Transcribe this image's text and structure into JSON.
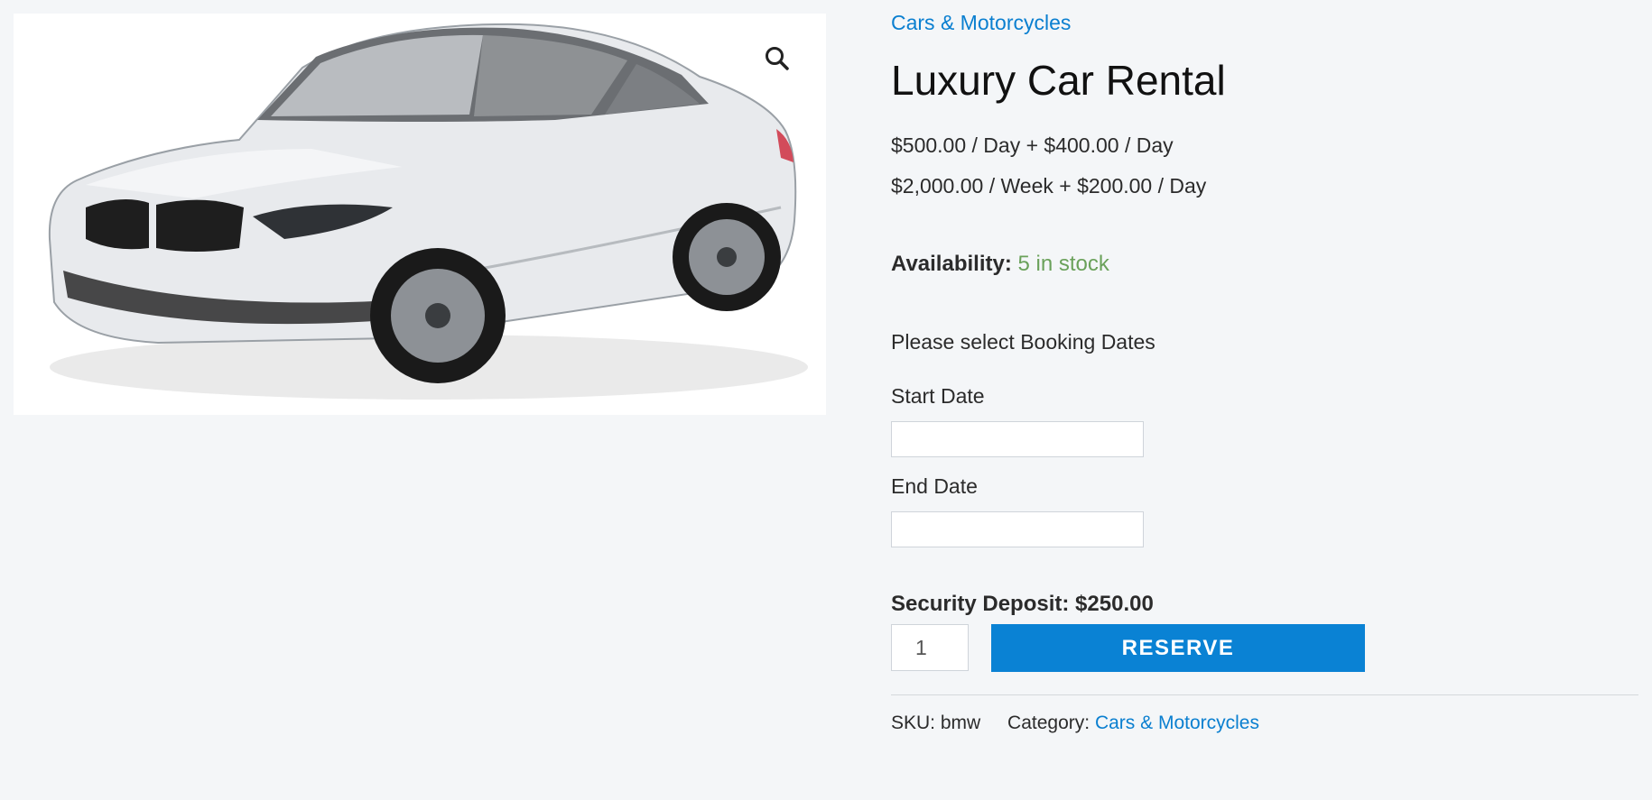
{
  "product": {
    "category_link": "Cars & Motorcycles",
    "title": "Luxury Car Rental",
    "price_line_1": "$500.00 / Day + $400.00 / Day",
    "price_line_2": "$2,000.00 / Week + $200.00 / Day",
    "availability_label": "Availability:",
    "availability_value": "5 in stock",
    "booking_note": "Please select Booking Dates",
    "start_date_label": "Start Date",
    "start_date_value": "",
    "end_date_label": "End Date",
    "end_date_value": "",
    "security_deposit": "Security Deposit: $250.00",
    "quantity": "1",
    "reserve_label": "RESERVE",
    "sku_label": "SKU:",
    "sku_value": "bmw",
    "category_label": "Category:",
    "category_value": "Cars & Motorcycles"
  },
  "gallery": {
    "zoom_icon": "magnifier-icon"
  },
  "colors": {
    "link": "#0a7fd0",
    "button": "#0a82d4",
    "in_stock": "#6aa15a",
    "page_background": "#f4f6f8"
  }
}
